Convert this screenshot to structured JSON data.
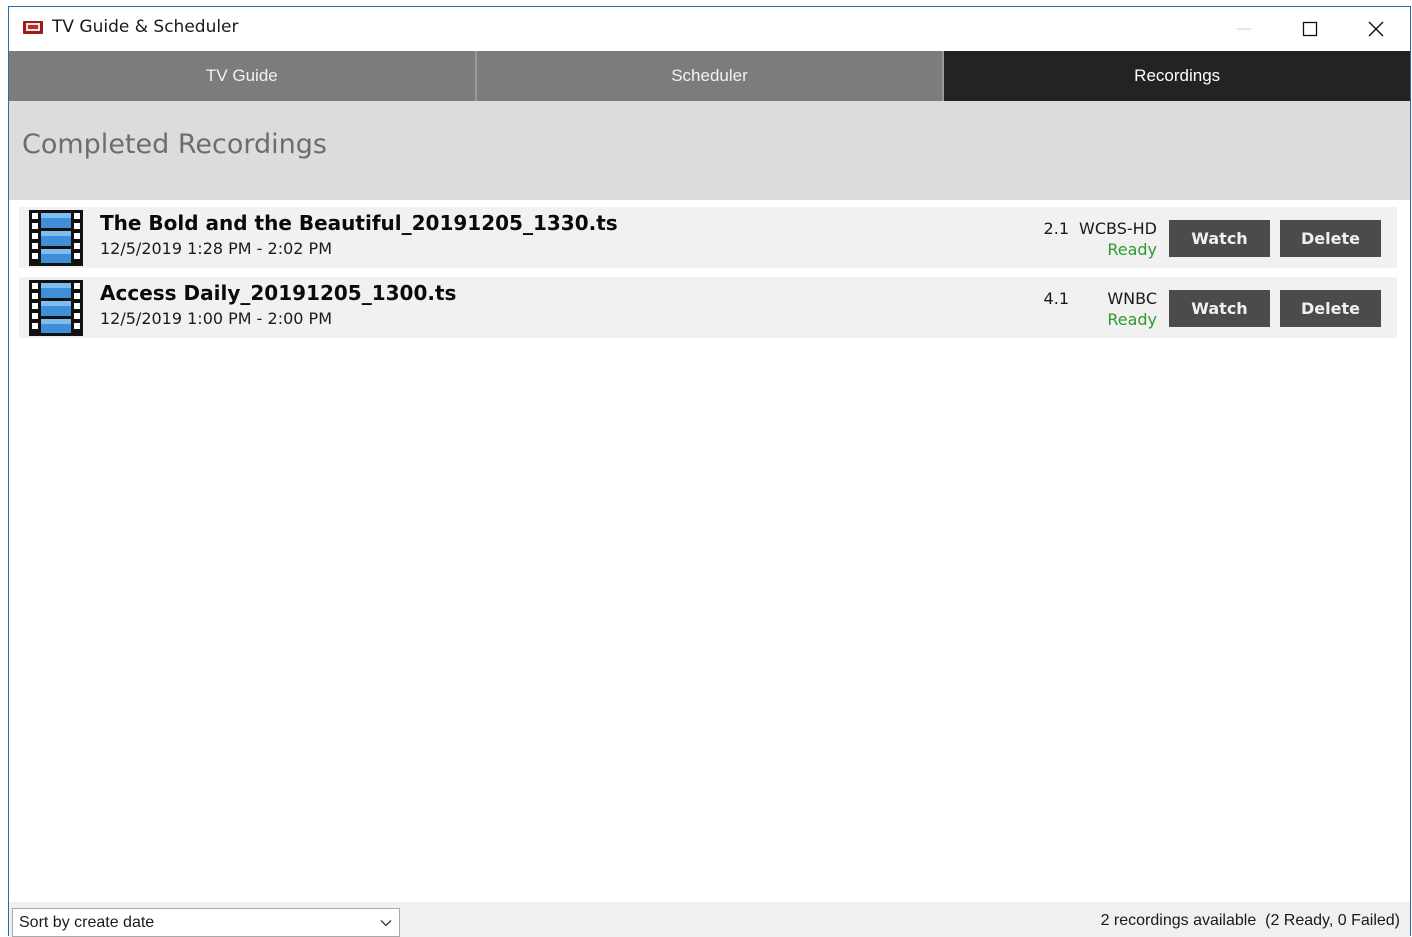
{
  "window": {
    "title": "TV Guide & Scheduler"
  },
  "tabs": [
    {
      "label": "TV Guide",
      "active": false
    },
    {
      "label": "Scheduler",
      "active": false
    },
    {
      "label": "Recordings",
      "active": true
    }
  ],
  "page_title": "Completed Recordings",
  "recordings": [
    {
      "title": "The Bold and the Beautiful_20191205_1330.ts",
      "time": "12/5/2019 1:28 PM - 2:02 PM",
      "channel_number": "2.1",
      "channel_name": "WCBS-HD",
      "status": "Ready",
      "watch_label": "Watch",
      "delete_label": "Delete"
    },
    {
      "title": "Access Daily_20191205_1300.ts",
      "time": "12/5/2019 1:00 PM - 2:00 PM",
      "channel_number": "4.1",
      "channel_name": "WNBC",
      "status": "Ready",
      "watch_label": "Watch",
      "delete_label": "Delete"
    }
  ],
  "footer": {
    "sort_value": "Sort by create date",
    "summary_count": "2 recordings available",
    "summary_detail": "(2 Ready, 0 Failed)"
  },
  "colors": {
    "tab_inactive": "#7c7c7c",
    "tab_active": "#232323",
    "button": "#4b4b4b",
    "status_ready": "#2e9a2e",
    "header_band": "#dcdcdc"
  },
  "icons": {
    "app": "tv-app-icon",
    "recording": "film-strip-icon",
    "minimize": "minimize-icon",
    "maximize": "maximize-icon",
    "close": "close-icon",
    "dropdown": "chevron-down-icon"
  }
}
